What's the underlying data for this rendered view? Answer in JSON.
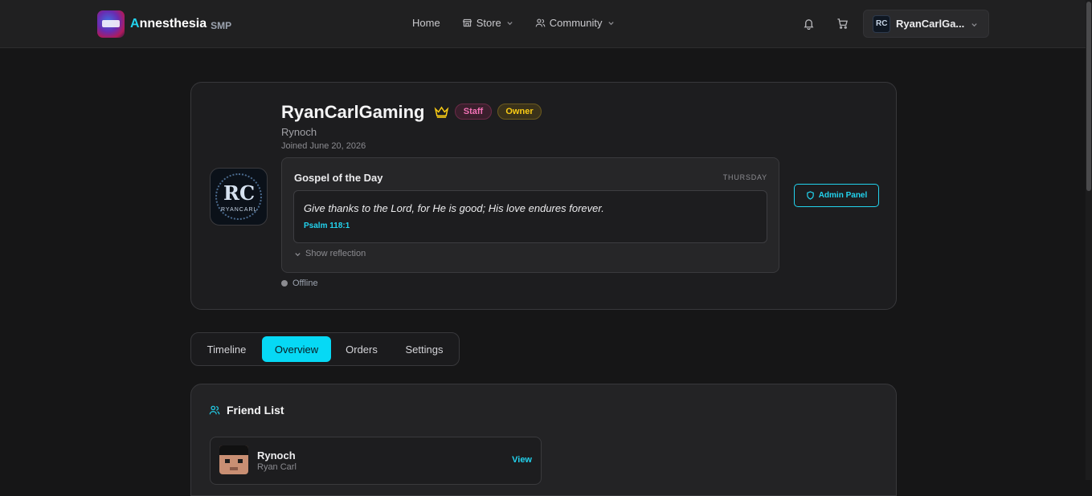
{
  "header": {
    "brand_first_letter": "A",
    "brand_rest": "nnesthesia",
    "brand_suffix": "SMP",
    "nav": [
      {
        "label": "Home",
        "icon": "none"
      },
      {
        "label": "Store",
        "icon": "store-icon"
      },
      {
        "label": "Community",
        "icon": "users-icon"
      }
    ],
    "user_name": "RyanCarlGa..."
  },
  "profile": {
    "name": "RyanCarlGaming",
    "badges": [
      "Staff",
      "Owner"
    ],
    "handle": "Rynoch",
    "joined": "Joined June 20, 2026",
    "status": "Offline",
    "admin_button": "Admin Panel",
    "avatar_initials": "RC",
    "avatar_caption": "RYANCARL"
  },
  "gospel": {
    "title": "Gospel of the Day",
    "day": "THURSDAY",
    "verse": "Give thanks to the Lord, for He is good; His love endures forever.",
    "reference": "Psalm 118:1",
    "reflection_toggle": "Show reflection"
  },
  "tabs": [
    {
      "label": "Timeline",
      "active": false
    },
    {
      "label": "Overview",
      "active": true
    },
    {
      "label": "Orders",
      "active": false
    },
    {
      "label": "Settings",
      "active": false
    }
  ],
  "friend_list": {
    "title": "Friend List",
    "friends": [
      {
        "name": "Rynoch",
        "subtitle": "Ryan Carl",
        "action": "View"
      }
    ]
  },
  "colors": {
    "accent": "#22d3ee",
    "staff": "#f472b6",
    "owner": "#facc15",
    "background": "#161617"
  }
}
